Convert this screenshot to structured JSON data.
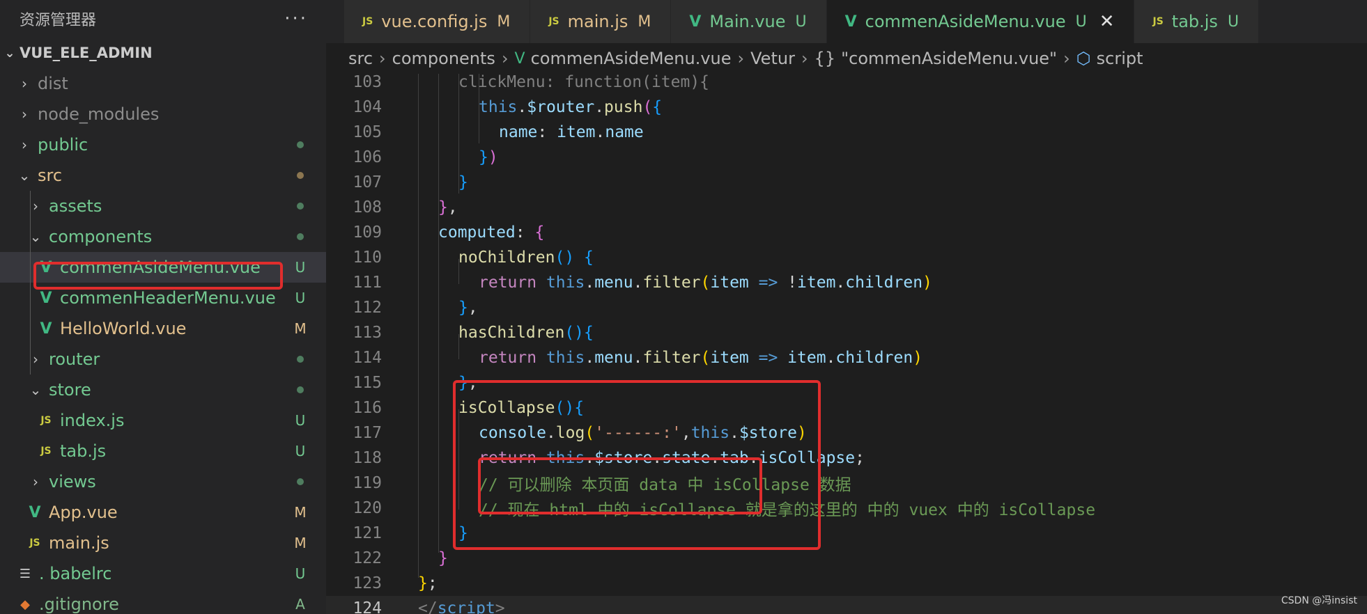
{
  "sidebar": {
    "title": "资源管理器",
    "more": "···",
    "project": "VUE_ELE_ADMIN",
    "items": [
      {
        "label": "dist",
        "status": ""
      },
      {
        "label": "node_modules",
        "status": ""
      },
      {
        "label": "public",
        "status": ""
      },
      {
        "label": "src",
        "status": ""
      },
      {
        "label": "assets",
        "status": ""
      },
      {
        "label": "components",
        "status": ""
      },
      {
        "label": "commenAsideMenu.vue",
        "status": "U"
      },
      {
        "label": "commenHeaderMenu.vue",
        "status": "U"
      },
      {
        "label": "HelloWorld.vue",
        "status": "M"
      },
      {
        "label": "router",
        "status": ""
      },
      {
        "label": "store",
        "status": ""
      },
      {
        "label": "index.js",
        "status": "U"
      },
      {
        "label": "tab.js",
        "status": "U"
      },
      {
        "label": "views",
        "status": ""
      },
      {
        "label": "App.vue",
        "status": "M"
      },
      {
        "label": "main.js",
        "status": "M"
      },
      {
        "label": ". babelrc",
        "status": "U"
      },
      {
        "label": ".gitignore",
        "status": "A"
      }
    ]
  },
  "icons": {
    "js": "JS",
    "vue": "V",
    "expanded": "⌄",
    "collapsed": "›",
    "config": "☰",
    "git": "◆",
    "close": "✕",
    "braces": "{}",
    "cube": "⬡"
  },
  "colors": {
    "untracked": "#73c991",
    "modified": "#e2c08d",
    "added": "#81b88b",
    "highlight": "#e02d2d"
  },
  "tabs": [
    {
      "label": "vue.config.js",
      "status": "M"
    },
    {
      "label": "main.js",
      "status": "M"
    },
    {
      "label": "Main.vue",
      "status": "U"
    },
    {
      "label": "commenAsideMenu.vue",
      "status": "U"
    },
    {
      "label": "tab.js",
      "status": "U"
    }
  ],
  "breadcrumb": [
    "src",
    "components",
    "commenAsideMenu.vue",
    "Vetur",
    "\"commenAsideMenu.vue\"",
    "script"
  ],
  "code": {
    "lines": [
      {
        "n": "103",
        "parts": [
          {
            "t": "clickMenu: function(item){",
            "c": "gr"
          }
        ]
      },
      {
        "n": "104",
        "parts": [
          {
            "t": "this",
            "c": "kb"
          },
          {
            "t": ".",
            "c": "pl"
          },
          {
            "t": "$router",
            "c": "vr"
          },
          {
            "t": ".",
            "c": "pl"
          },
          {
            "t": "push",
            "c": "fn"
          },
          {
            "t": "(",
            "c": "p2"
          },
          {
            "t": "{",
            "c": "p3"
          }
        ]
      },
      {
        "n": "105",
        "parts": [
          {
            "t": "name",
            "c": "vr"
          },
          {
            "t": ": ",
            "c": "pl"
          },
          {
            "t": "item",
            "c": "vr"
          },
          {
            "t": ".",
            "c": "pl"
          },
          {
            "t": "name",
            "c": "vr"
          }
        ]
      },
      {
        "n": "106",
        "parts": [
          {
            "t": "}",
            "c": "p3"
          },
          {
            "t": ")",
            "c": "p2"
          }
        ]
      },
      {
        "n": "107",
        "parts": [
          {
            "t": "}",
            "c": "p3"
          }
        ]
      },
      {
        "n": "108",
        "parts": [
          {
            "t": "}",
            "c": "p2"
          },
          {
            "t": ",",
            "c": "pl"
          }
        ]
      },
      {
        "n": "109",
        "parts": [
          {
            "t": "computed",
            "c": "vr"
          },
          {
            "t": ": ",
            "c": "pl"
          },
          {
            "t": "{",
            "c": "p2"
          }
        ]
      },
      {
        "n": "110",
        "parts": [
          {
            "t": "noChildren",
            "c": "fn"
          },
          {
            "t": "()",
            "c": "p3"
          },
          {
            "t": " ",
            "c": "pl"
          },
          {
            "t": "{",
            "c": "p3"
          }
        ]
      },
      {
        "n": "111",
        "parts": [
          {
            "t": "return ",
            "c": "kw"
          },
          {
            "t": "this",
            "c": "kb"
          },
          {
            "t": ".",
            "c": "pl"
          },
          {
            "t": "menu",
            "c": "vr"
          },
          {
            "t": ".",
            "c": "pl"
          },
          {
            "t": "filter",
            "c": "fn"
          },
          {
            "t": "(",
            "c": "p1"
          },
          {
            "t": "item",
            "c": "vr"
          },
          {
            "t": " => ",
            "c": "kb"
          },
          {
            "t": "!",
            "c": "pl"
          },
          {
            "t": "item",
            "c": "vr"
          },
          {
            "t": ".",
            "c": "pl"
          },
          {
            "t": "children",
            "c": "vr"
          },
          {
            "t": ")",
            "c": "p1"
          }
        ]
      },
      {
        "n": "112",
        "parts": [
          {
            "t": "}",
            "c": "p3"
          },
          {
            "t": ",",
            "c": "pl"
          }
        ]
      },
      {
        "n": "113",
        "parts": [
          {
            "t": "hasChildren",
            "c": "fn"
          },
          {
            "t": "()",
            "c": "p3"
          },
          {
            "t": "{",
            "c": "p3"
          }
        ]
      },
      {
        "n": "114",
        "parts": [
          {
            "t": "return ",
            "c": "kw"
          },
          {
            "t": "this",
            "c": "kb"
          },
          {
            "t": ".",
            "c": "pl"
          },
          {
            "t": "menu",
            "c": "vr"
          },
          {
            "t": ".",
            "c": "pl"
          },
          {
            "t": "filter",
            "c": "fn"
          },
          {
            "t": "(",
            "c": "p1"
          },
          {
            "t": "item",
            "c": "vr"
          },
          {
            "t": " => ",
            "c": "kb"
          },
          {
            "t": "item",
            "c": "vr"
          },
          {
            "t": ".",
            "c": "pl"
          },
          {
            "t": "children",
            "c": "vr"
          },
          {
            "t": ")",
            "c": "p1"
          }
        ]
      },
      {
        "n": "115",
        "parts": [
          {
            "t": "}",
            "c": "p3"
          },
          {
            "t": ",",
            "c": "pl"
          }
        ]
      },
      {
        "n": "116",
        "parts": [
          {
            "t": "isCollapse",
            "c": "fn"
          },
          {
            "t": "()",
            "c": "p3"
          },
          {
            "t": "{",
            "c": "p3"
          }
        ]
      },
      {
        "n": "117",
        "parts": [
          {
            "t": "console",
            "c": "vr"
          },
          {
            "t": ".",
            "c": "pl"
          },
          {
            "t": "log",
            "c": "fn"
          },
          {
            "t": "(",
            "c": "p1"
          },
          {
            "t": "'------:'",
            "c": "st"
          },
          {
            "t": ",",
            "c": "pl"
          },
          {
            "t": "this",
            "c": "kb"
          },
          {
            "t": ".",
            "c": "pl"
          },
          {
            "t": "$store",
            "c": "vr"
          },
          {
            "t": ")",
            "c": "p1"
          }
        ]
      },
      {
        "n": "118",
        "parts": [
          {
            "t": "return ",
            "c": "kw"
          },
          {
            "t": "this",
            "c": "kb"
          },
          {
            "t": ".",
            "c": "pl"
          },
          {
            "t": "$store",
            "c": "vr"
          },
          {
            "t": ".",
            "c": "pl"
          },
          {
            "t": "state",
            "c": "vr"
          },
          {
            "t": ".",
            "c": "pl"
          },
          {
            "t": "tab",
            "c": "vr"
          },
          {
            "t": ".",
            "c": "pl"
          },
          {
            "t": "isCollapse",
            "c": "vr"
          },
          {
            "t": ";",
            "c": "pl"
          }
        ]
      },
      {
        "n": "119",
        "parts": [
          {
            "t": "// 可以删除 本页面 data 中 isCollapse 数据",
            "c": "cm"
          }
        ]
      },
      {
        "n": "120",
        "parts": [
          {
            "t": "// 现在 html 中的 isCollapse 就是拿的这里的 中的 vuex 中的 isCollapse",
            "c": "cm"
          }
        ]
      },
      {
        "n": "121",
        "parts": [
          {
            "t": "}",
            "c": "p3"
          }
        ]
      },
      {
        "n": "122",
        "parts": [
          {
            "t": "}",
            "c": "p2"
          }
        ]
      },
      {
        "n": "123",
        "parts": [
          {
            "t": "}",
            "c": "p1"
          },
          {
            "t": ";",
            "c": "pl"
          }
        ]
      },
      {
        "n": "124",
        "parts": [
          {
            "t": "</",
            "c": "gr"
          },
          {
            "t": "script",
            "c": "tg"
          },
          {
            "t": ">",
            "c": "gr"
          }
        ]
      }
    ]
  },
  "watermark": "CSDN @冯insist"
}
